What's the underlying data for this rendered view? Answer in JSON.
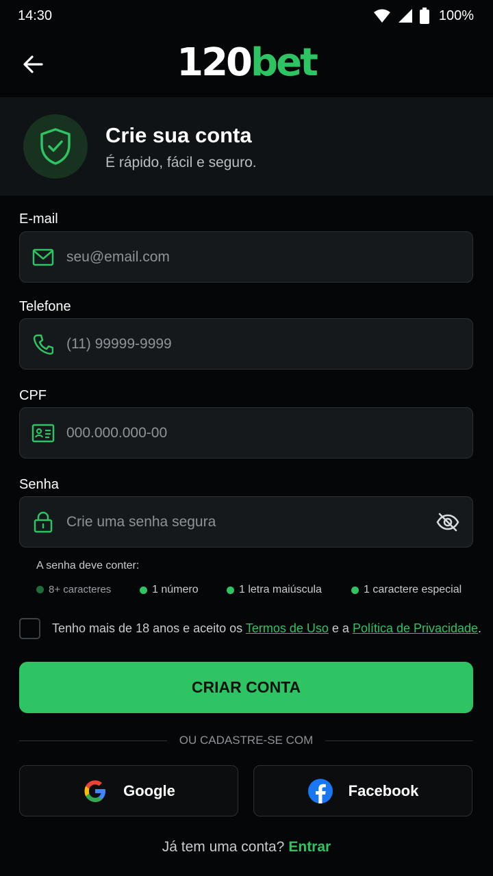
{
  "status_bar": {
    "time": "14:30",
    "battery": "100%"
  },
  "header": {
    "logo_number": "120",
    "logo_word": "bet"
  },
  "hero": {
    "title": "Crie sua conta",
    "subtitle": "É rápido, fácil e seguro."
  },
  "form": {
    "email": {
      "label": "E-mail",
      "placeholder": "seu@email.com",
      "icon": "mail-icon"
    },
    "phone": {
      "label": "Telefone",
      "placeholder": "(11) 99999-9999",
      "icon": "phone-icon"
    },
    "cpf": {
      "label": "CPF",
      "placeholder": "000.000.000-00",
      "icon": "id-card-icon"
    },
    "password": {
      "label": "Senha",
      "placeholder": "Crie uma senha segura",
      "icon": "lock-icon"
    }
  },
  "password_rules": {
    "title": "A senha deve conter:",
    "items": [
      "8+ caracteres",
      "1 número",
      "1 letra maiúscula",
      "1 caractere especial"
    ]
  },
  "terms": {
    "prefix": "Tenho mais de 18 anos e aceito os ",
    "terms_link": "Termos de Uso",
    "middle": " e a ",
    "privacy_link": "Política de Privacidade",
    "suffix": "."
  },
  "cta": {
    "label": "CRIAR CONTA"
  },
  "divider": {
    "text": "OU CADASTRE-SE COM"
  },
  "social": {
    "google": "Google",
    "facebook": "Facebook"
  },
  "login": {
    "question": "Já tem uma conta?",
    "link": "Entrar"
  },
  "colors": {
    "accent": "#2fc463",
    "background": "#050607",
    "field": "#15191c",
    "facebook": "#1877f2"
  }
}
